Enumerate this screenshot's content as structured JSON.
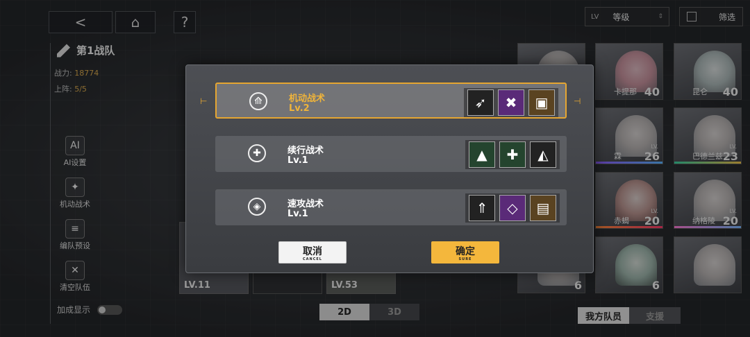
{
  "nav": {
    "back_icon": "<",
    "home_icon": "home-icon",
    "help_icon": "?"
  },
  "team": {
    "name": "第1战队",
    "power_label": "战力:",
    "power_value": "18774",
    "deploy_label": "上阵:",
    "deploy_value": "5/5"
  },
  "side_menu": [
    {
      "label": "AI设置",
      "icon": "ai-icon"
    },
    {
      "label": "机动战术",
      "icon": "tactic-icon"
    },
    {
      "label": "编队预设",
      "icon": "preset-icon"
    },
    {
      "label": "清空队伍",
      "icon": "clear-icon"
    }
  ],
  "toggle_label": "加成显示",
  "sort": {
    "lv": "LV",
    "label": "等级"
  },
  "filter_label": "筛选",
  "roster": [
    {
      "name": "",
      "level": ""
    },
    {
      "name": "卡提那",
      "level": "40"
    },
    {
      "name": "昆仑",
      "level": "40"
    },
    {
      "name": "霖",
      "level": "26"
    },
    {
      "name": "巴德兰兹",
      "level": "23"
    },
    {
      "name": "赤蝎",
      "level": "20"
    },
    {
      "name": "纳格陵",
      "level": "20"
    },
    {
      "name": "",
      "level": "6"
    },
    {
      "name": "",
      "level": "6"
    }
  ],
  "lineup_levels": [
    "LV.11",
    "LV.53"
  ],
  "dialog": {
    "options": [
      {
        "title": "机动战术",
        "level": "Lv.2",
        "selected": true
      },
      {
        "title": "续行战术",
        "level": "Lv.1",
        "selected": false
      },
      {
        "title": "速攻战术",
        "level": "Lv.1",
        "selected": false
      }
    ],
    "cancel_label": "取消",
    "cancel_sub": "CANCEL",
    "confirm_label": "确定",
    "confirm_sub": "SURE"
  },
  "view_modes": [
    "2D",
    "3D"
  ],
  "team_tabs": [
    "我方队员",
    "支援"
  ],
  "colors": {
    "accent": "#e6a631",
    "confirm": "#f4b73c"
  }
}
